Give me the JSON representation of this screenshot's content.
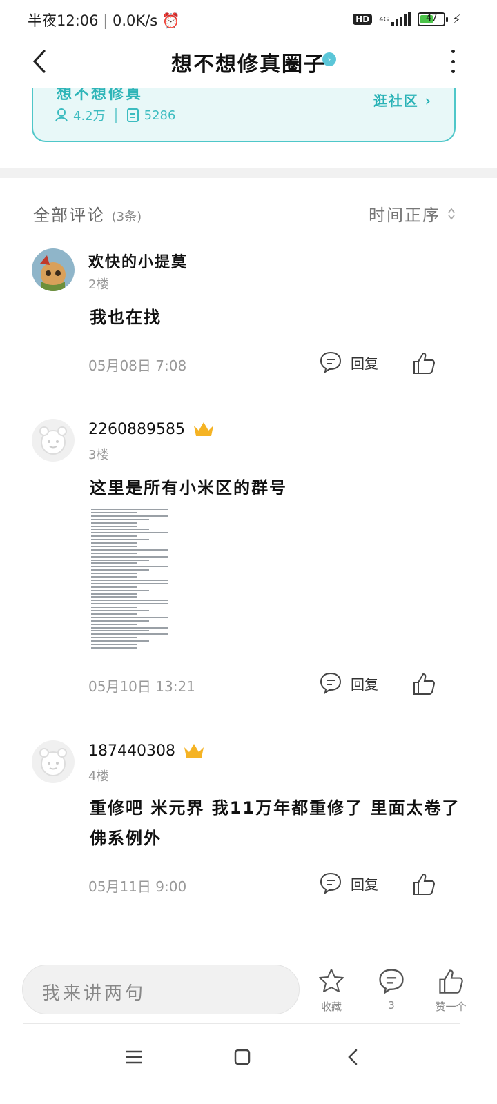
{
  "status": {
    "time": "半夜12:06",
    "speed": "0.0K/s",
    "hd": "HD",
    "net": "4G",
    "battery": "47"
  },
  "header": {
    "title": "想不想修真圈子",
    "back_label": "返回"
  },
  "card": {
    "name_peek": "想不想修真",
    "members": "4.2万",
    "posts": "5286",
    "visit": "逛社区"
  },
  "comments_header": {
    "all": "全部评论",
    "count": "(3条)",
    "sort": "时间正序"
  },
  "comments": [
    {
      "user": "欢快的小提莫",
      "floor": "2楼",
      "text": "我也在找",
      "date": "05月08日  7:08",
      "reply": "回复"
    },
    {
      "user": "2260889585",
      "floor": "3楼",
      "text": "这里是所有小米区的群号",
      "date": "05月10日  13:21",
      "reply": "回复"
    },
    {
      "user": "187440308",
      "floor": "4楼",
      "text": "重修吧 米元界 我11万年都重修了 里面太卷了 佛系例外",
      "date": "05月11日  9:00",
      "reply": "回复"
    }
  ],
  "bottom": {
    "placeholder": "我来讲两句",
    "fav": "收藏",
    "comments": "3",
    "like": "赞一个"
  },
  "icons": {
    "crown": "crown-icon",
    "chat": "chat-icon",
    "thumb": "thumb-up-icon",
    "star": "star-icon"
  },
  "colors": {
    "accent": "#4fc7c9",
    "crown": "#f5b324"
  }
}
